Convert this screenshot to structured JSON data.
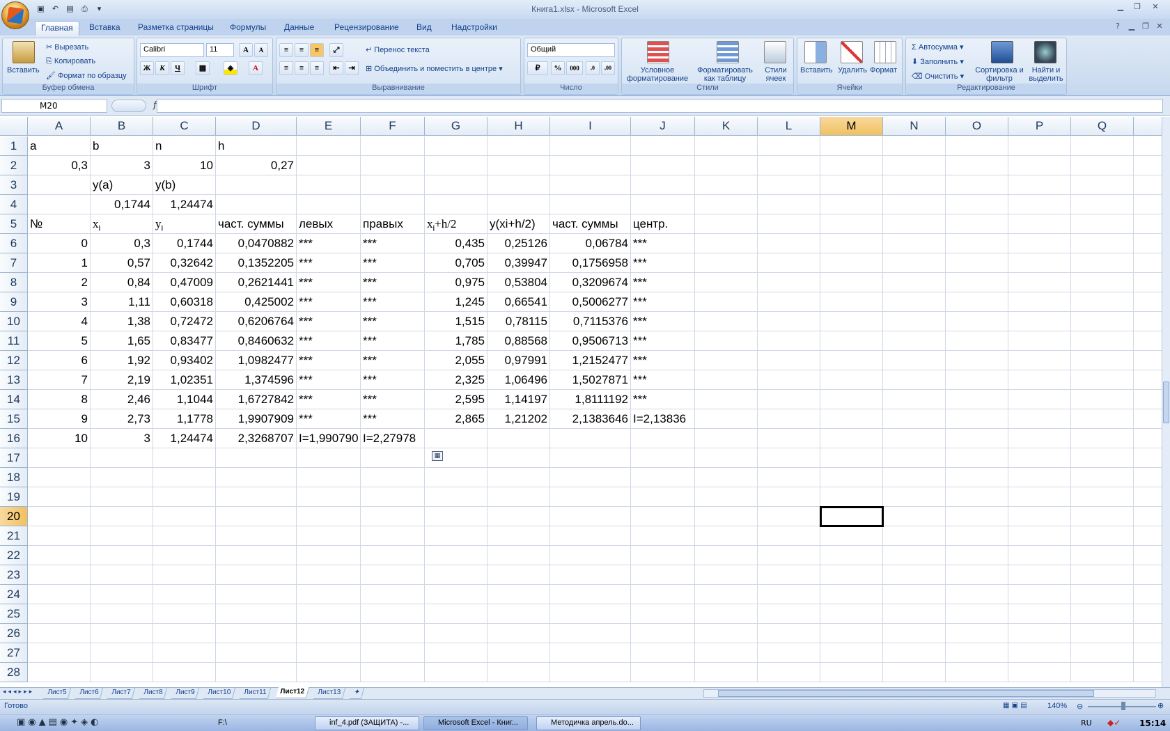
{
  "window": {
    "title": "Книга1.xlsx - Microsoft Excel"
  },
  "tabs": [
    "Главная",
    "Вставка",
    "Разметка страницы",
    "Формулы",
    "Данные",
    "Рецензирование",
    "Вид",
    "Надстройки"
  ],
  "ribbon": {
    "clipboard": {
      "title": "Буфер обмена",
      "paste": "Вставить",
      "cut": "Вырезать",
      "copy": "Копировать",
      "format_painter": "Формат по образцу"
    },
    "font": {
      "title": "Шрифт",
      "font_name": "Calibri",
      "font_size": "11",
      "bold": "Ж",
      "italic": "К",
      "underline": "Ч"
    },
    "alignment": {
      "title": "Выравнивание",
      "wrap": "Перенос текста",
      "merge": "Объединить и поместить в центре"
    },
    "number": {
      "title": "Число",
      "format": "Общий",
      "percent": "%",
      "thousands": "000"
    },
    "styles": {
      "title": "Стили",
      "conditional": "Условное форматирование",
      "format_table": "Форматировать как таблицу",
      "cell_styles": "Стили ячеек"
    },
    "cells": {
      "title": "Ячейки",
      "insert": "Вставить",
      "delete": "Удалить",
      "format": "Формат"
    },
    "editing": {
      "title": "Редактирование",
      "autosum": "Автосумма",
      "fill": "Заполнить",
      "clear": "Очистить",
      "sort": "Сортировка и фильтр",
      "find": "Найти и выделить"
    }
  },
  "formula_bar": {
    "name_box": "M20",
    "fx": "fx",
    "value": ""
  },
  "columns": [
    "A",
    "B",
    "C",
    "D",
    "E",
    "F",
    "G",
    "H",
    "I",
    "J",
    "K",
    "L",
    "M",
    "N",
    "O",
    "P",
    "Q"
  ],
  "rows": [
    "1",
    "2",
    "3",
    "4",
    "5",
    "6",
    "7",
    "8",
    "9",
    "10",
    "11",
    "12",
    "13",
    "14",
    "15",
    "16",
    "17",
    "18",
    "19",
    "20",
    "21",
    "22",
    "23",
    "24",
    "25",
    "26",
    "27",
    "28"
  ],
  "cells": {
    "r1": [
      "a",
      "b",
      "n",
      "h"
    ],
    "r2": [
      "0,3",
      "3",
      "10",
      "0,27"
    ],
    "r3": [
      "y(a)",
      "y(b)"
    ],
    "r4": [
      "0,1744",
      "1,24474"
    ],
    "r5": [
      "№",
      "x",
      "i",
      "y",
      "i",
      "част. суммы",
      "левых",
      "правых",
      "x",
      "i",
      "+h/2",
      "y(xi+h/2)",
      "част. суммы",
      "центр."
    ],
    "data": [
      [
        "0",
        "0,3",
        "0,1744",
        "0,0470882",
        "***",
        "***",
        "0,435",
        "0,25126",
        "0,06784",
        "***"
      ],
      [
        "1",
        "0,57",
        "0,32642",
        "0,1352205",
        "***",
        "***",
        "0,705",
        "0,39947",
        "0,1756958",
        "***"
      ],
      [
        "2",
        "0,84",
        "0,47009",
        "0,2621441",
        "***",
        "***",
        "0,975",
        "0,53804",
        "0,3209674",
        "***"
      ],
      [
        "3",
        "1,11",
        "0,60318",
        "0,425002",
        "***",
        "***",
        "1,245",
        "0,66541",
        "0,5006277",
        "***"
      ],
      [
        "4",
        "1,38",
        "0,72472",
        "0,6206764",
        "***",
        "***",
        "1,515",
        "0,78115",
        "0,7115376",
        "***"
      ],
      [
        "5",
        "1,65",
        "0,83477",
        "0,8460632",
        "***",
        "***",
        "1,785",
        "0,88568",
        "0,9506713",
        "***"
      ],
      [
        "6",
        "1,92",
        "0,93402",
        "1,0982477",
        "***",
        "***",
        "2,055",
        "0,97991",
        "1,2152477",
        "***"
      ],
      [
        "7",
        "2,19",
        "1,02351",
        "1,374596",
        "***",
        "***",
        "2,325",
        "1,06496",
        "1,5027871",
        "***"
      ],
      [
        "8",
        "2,46",
        "1,1044",
        "1,6727842",
        "***",
        "***",
        "2,595",
        "1,14197",
        "1,8111192",
        "***"
      ],
      [
        "9",
        "2,73",
        "1,1778",
        "1,9907909",
        "***",
        "***",
        "2,865",
        "1,21202",
        "2,1383646",
        "I=2,13836"
      ]
    ],
    "r16": [
      "10",
      "3",
      "1,24474",
      "2,3268707",
      "I=1,990790",
      "I=2,27978"
    ]
  },
  "sheets": [
    "Лист5",
    "Лист6",
    "Лист7",
    "Лист8",
    "Лист9",
    "Лист10",
    "Лист11",
    "Лист12",
    "Лист13"
  ],
  "active_sheet": "Лист12",
  "status": {
    "ready": "Готово",
    "zoom": "140%"
  },
  "taskbar": {
    "items": [
      "F:\\",
      "inf_4.pdf (ЗАЩИТА) -...",
      "Microsoft Excel - Книг...",
      "Методичка апрель.do..."
    ],
    "lang": "RU",
    "clock": "15:14"
  }
}
